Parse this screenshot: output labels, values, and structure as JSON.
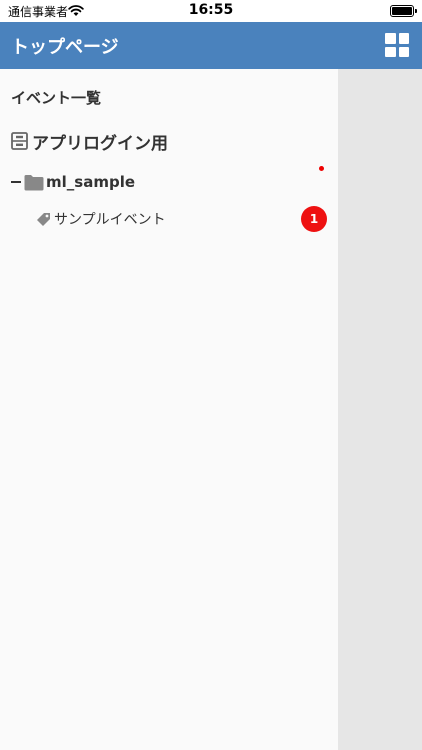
{
  "status": {
    "carrier": "通信事業者",
    "time": "16:55"
  },
  "navbar": {
    "title": "トップページ"
  },
  "drawer": {
    "title": "イベント一覧",
    "login_item": "アプリログイン用",
    "folder_item": "ml_sample",
    "event_item": "サンプルイベント",
    "event_badge": "1"
  },
  "colors": {
    "navbar": "#4a82bd",
    "badge": "#ee1111",
    "drawer_bg": "#fafafa",
    "content_bg": "#e6e6e6"
  },
  "icons": [
    "wifi-icon",
    "battery-icon",
    "grid-menu-icon",
    "cabinet-icon",
    "collapse-minus-icon",
    "folder-icon",
    "tag-icon"
  ]
}
